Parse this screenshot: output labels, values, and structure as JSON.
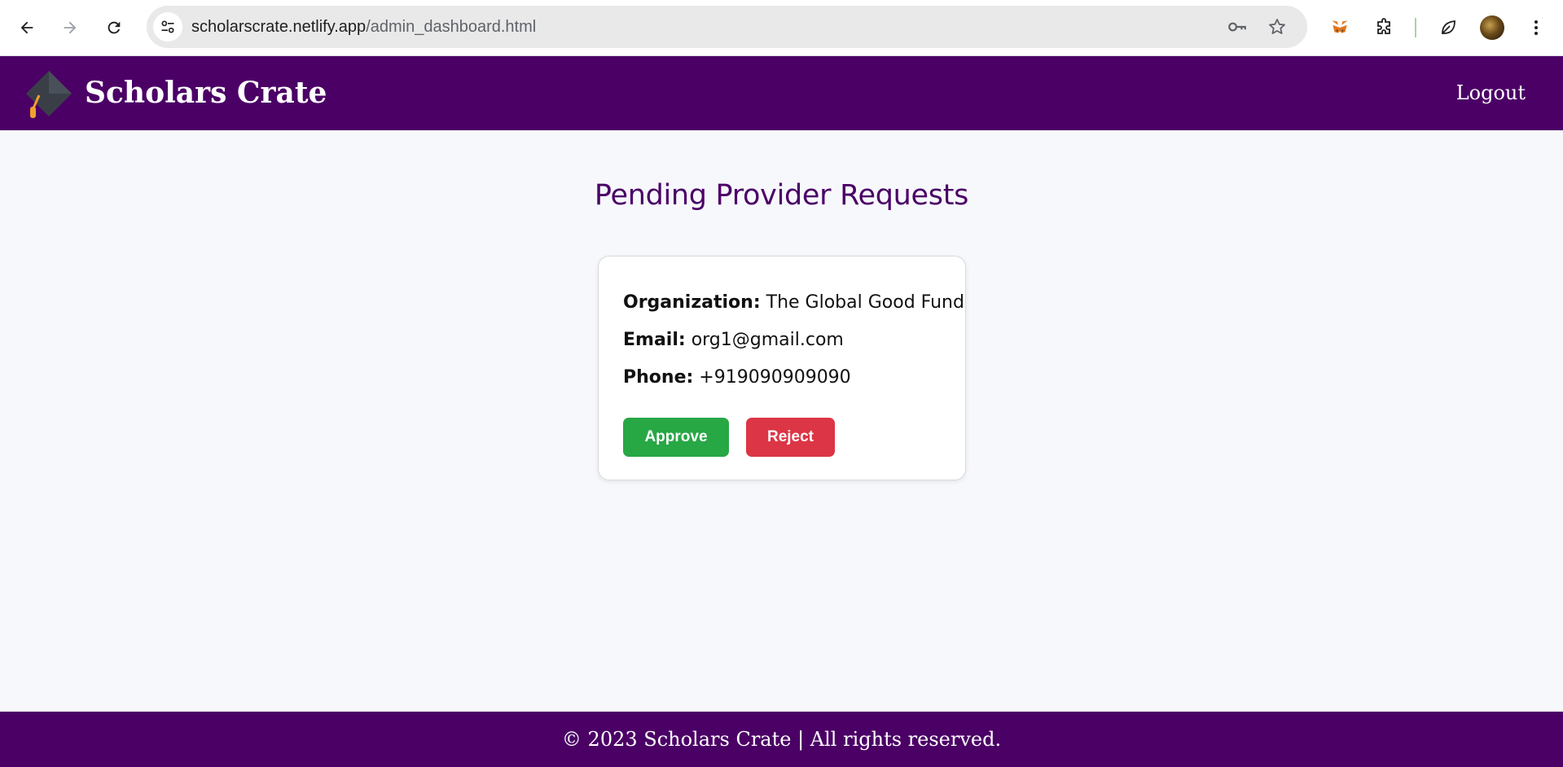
{
  "browser": {
    "url_host": "scholarscrate.netlify.app",
    "url_path": "/admin_dashboard.html",
    "icons": [
      "back-arrow-icon",
      "forward-arrow-icon",
      "reload-icon",
      "site-info-icon",
      "password-key-icon",
      "bookmark-star-icon",
      "metamask-fox-icon",
      "extensions-puzzle-icon",
      "leaf-extension-icon",
      "profile-avatar",
      "more-menu-icon"
    ]
  },
  "header": {
    "brand": "Scholars Crate",
    "logout_label": "Logout",
    "background_color": "#4b0066"
  },
  "main": {
    "title": "Pending Provider Requests",
    "requests": [
      {
        "organization_label": "Organization:",
        "organization_value": "The Global Good Fund",
        "email_label": "Email:",
        "email_value": "org1@gmail.com",
        "phone_label": "Phone:",
        "phone_value": "+919090909090",
        "approve_label": "Approve",
        "reject_label": "Reject"
      }
    ]
  },
  "footer": {
    "text": "© 2023 Scholars Crate | All rights reserved."
  },
  "colors": {
    "approve": "#28a745",
    "reject": "#dc3545",
    "page_bg": "#f7f8fc"
  }
}
